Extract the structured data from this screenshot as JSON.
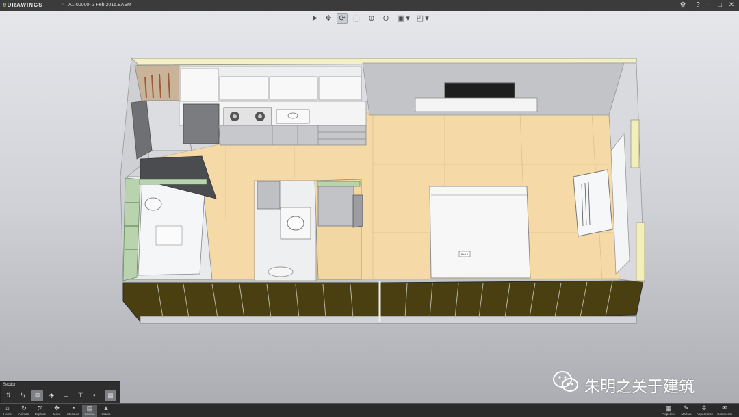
{
  "titlebar": {
    "app_logo": "DRAWINGS",
    "app_logo_prefix": "e",
    "tab_separator": "»",
    "document_title": "A1-00000- 3 Feb 2016.EASM",
    "controls": {
      "settings_icon": "⚙",
      "help_icon": "?",
      "minimize": "–",
      "maximize": "□",
      "close": "✕"
    }
  },
  "view_toolbar": {
    "tools": [
      {
        "name": "select-tool",
        "icon": "➤"
      },
      {
        "name": "pan-tool",
        "icon": "✥"
      },
      {
        "name": "rotate-tool",
        "icon": "⟳",
        "active": true
      },
      {
        "name": "zoom-window-tool",
        "icon": "⬚"
      },
      {
        "name": "zoom-in-tool",
        "icon": "⊕"
      },
      {
        "name": "zoom-out-tool",
        "icon": "⊖"
      },
      {
        "name": "display-style-tool",
        "icon": "▣"
      },
      {
        "name": "display-style-dropdown",
        "icon": "▾"
      },
      {
        "name": "view-orientation-tool",
        "icon": "◰"
      },
      {
        "name": "view-orientation-dropdown",
        "icon": "▾"
      }
    ]
  },
  "model": {
    "bed_tag": "Bed 1"
  },
  "section_panel": {
    "title": "Section",
    "tools": [
      {
        "name": "section-tool-1",
        "icon": "⇅"
      },
      {
        "name": "section-tool-2",
        "icon": "⇆"
      },
      {
        "name": "section-tool-3",
        "icon": "⊟",
        "active": true
      },
      {
        "name": "section-tool-4",
        "icon": "◈"
      },
      {
        "name": "section-tool-5",
        "icon": "⊥"
      },
      {
        "name": "section-tool-6",
        "icon": "⊤"
      },
      {
        "name": "section-tool-7",
        "icon": "◐"
      },
      {
        "name": "section-tool-8",
        "icon": "▦",
        "active": true
      }
    ]
  },
  "bottom_toolbar": {
    "left": [
      {
        "name": "home-button",
        "icon": "⌂",
        "label": "Home"
      },
      {
        "name": "animate-button",
        "icon": "↻",
        "label": "Animate"
      },
      {
        "name": "explode-button",
        "icon": "⤧",
        "label": "Explode"
      },
      {
        "name": "move-button",
        "icon": "✥",
        "label": "Move"
      },
      {
        "name": "measure-button",
        "icon": "◔",
        "label": "Measure"
      },
      {
        "name": "section-button",
        "icon": "▤",
        "label": "Section",
        "active": true
      },
      {
        "name": "stamp-button",
        "icon": "⊻",
        "label": "Stamp"
      }
    ],
    "right": [
      {
        "name": "properties-button",
        "icon": "▦",
        "label": "Properties"
      },
      {
        "name": "markup-button",
        "icon": "✎",
        "label": "Markup"
      },
      {
        "name": "appearance-button",
        "icon": "✲",
        "label": "Appearance"
      },
      {
        "name": "comments-button",
        "icon": "✉",
        "label": "Comments"
      }
    ]
  },
  "watermark": {
    "text": "朱明之关于建筑"
  }
}
